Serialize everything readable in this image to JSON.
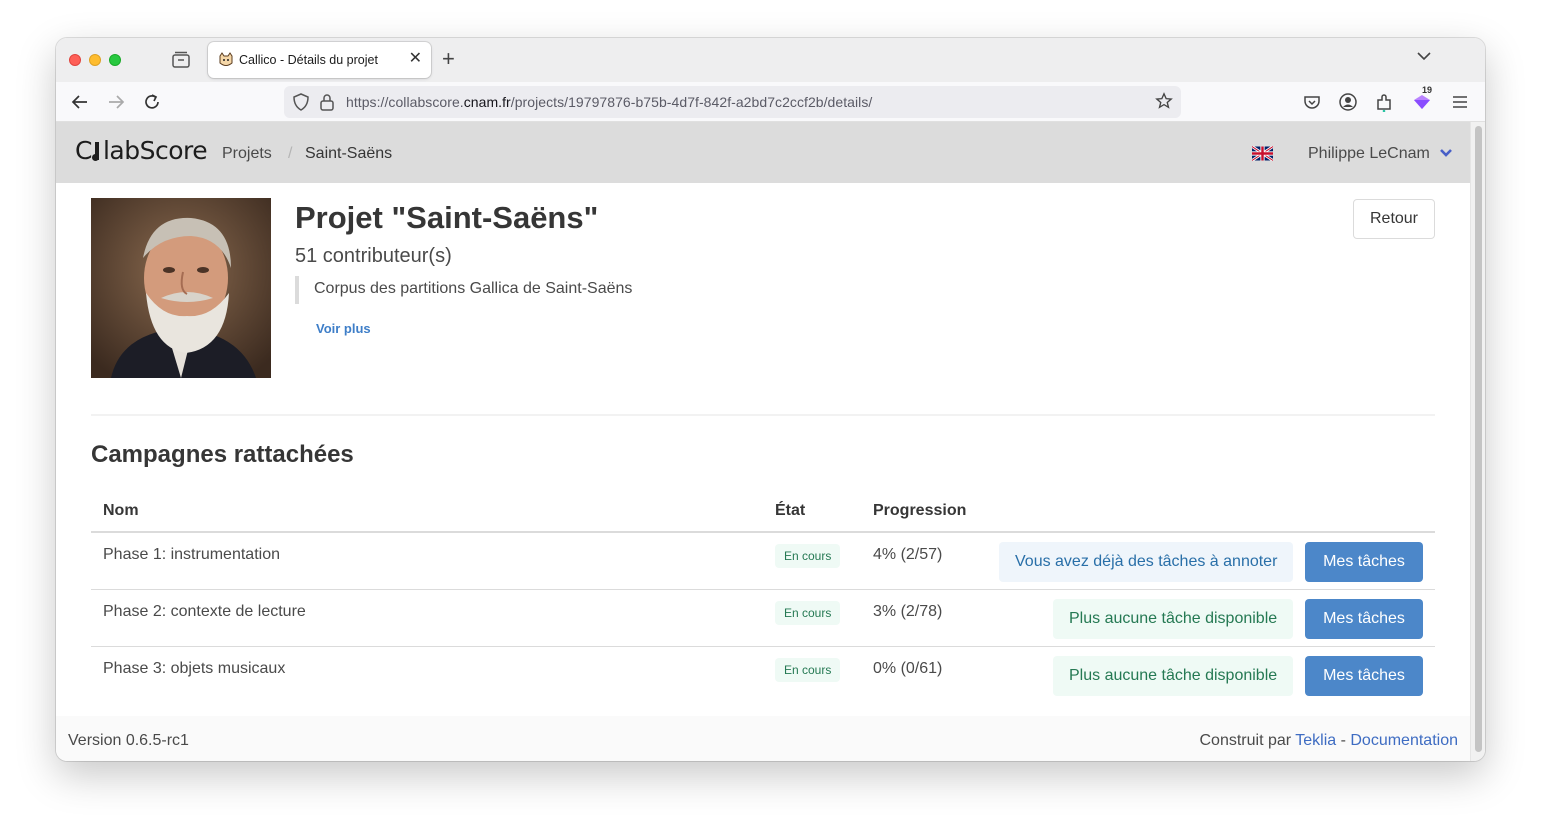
{
  "browser": {
    "tab_title": "Callico - Détails du projet",
    "url_prefix": "https://collabscore.",
    "url_domain": "cnam.fr",
    "url_path": "/projects/19797876-b75b-4d7f-842f-a2bd7c2ccf2b/details/",
    "extension_badge": "19",
    "icons": [
      "back-icon",
      "forward-icon",
      "reload-icon",
      "shield-icon",
      "lock-icon",
      "star-icon",
      "pocket-icon",
      "account-icon",
      "extensions-icon",
      "menu-icon"
    ]
  },
  "header": {
    "logo_prefix": "C",
    "logo_mid": "labScore",
    "breadcrumb_root": "Projets",
    "breadcrumb_sep": "/",
    "breadcrumb_current": "Saint-Saëns",
    "user_name": "Philippe LeCnam"
  },
  "project": {
    "title": "Projet \"Saint-Saëns\"",
    "contributors": "51 contributeur(s)",
    "description": "Corpus des partitions Gallica de Saint-Saëns",
    "voir_plus": "Voir plus",
    "retour_label": "Retour"
  },
  "campaigns": {
    "section_title": "Campagnes rattachées",
    "headers": {
      "nom": "Nom",
      "etat": "État",
      "progression": "Progression"
    },
    "rows": [
      {
        "name": "Phase 1: instrumentation",
        "status": "En cours",
        "progress": "4% (2/57)",
        "info": "Vous avez déjà des tâches à annoter",
        "action": "Mes tâches"
      },
      {
        "name": "Phase 2: contexte de lecture",
        "status": "En cours",
        "progress": "3% (2/78)",
        "info": "Plus aucune tâche disponible",
        "action": "Mes tâches"
      },
      {
        "name": "Phase 3: objets musicaux",
        "status": "En cours",
        "progress": "0% (0/61)",
        "info": "Plus aucune tâche disponible",
        "action": "Mes tâches"
      }
    ]
  },
  "footer": {
    "version": "Version 0.6.5-rc1",
    "built_by": "Construit par",
    "teklia": "Teklia",
    "dash": "-",
    "documentation": "Documentation"
  },
  "colors": {
    "primary_button": "#4c87c9",
    "status_green": "#257953",
    "info_blue": "#296fa8",
    "header_bg": "#dcdcdc"
  }
}
